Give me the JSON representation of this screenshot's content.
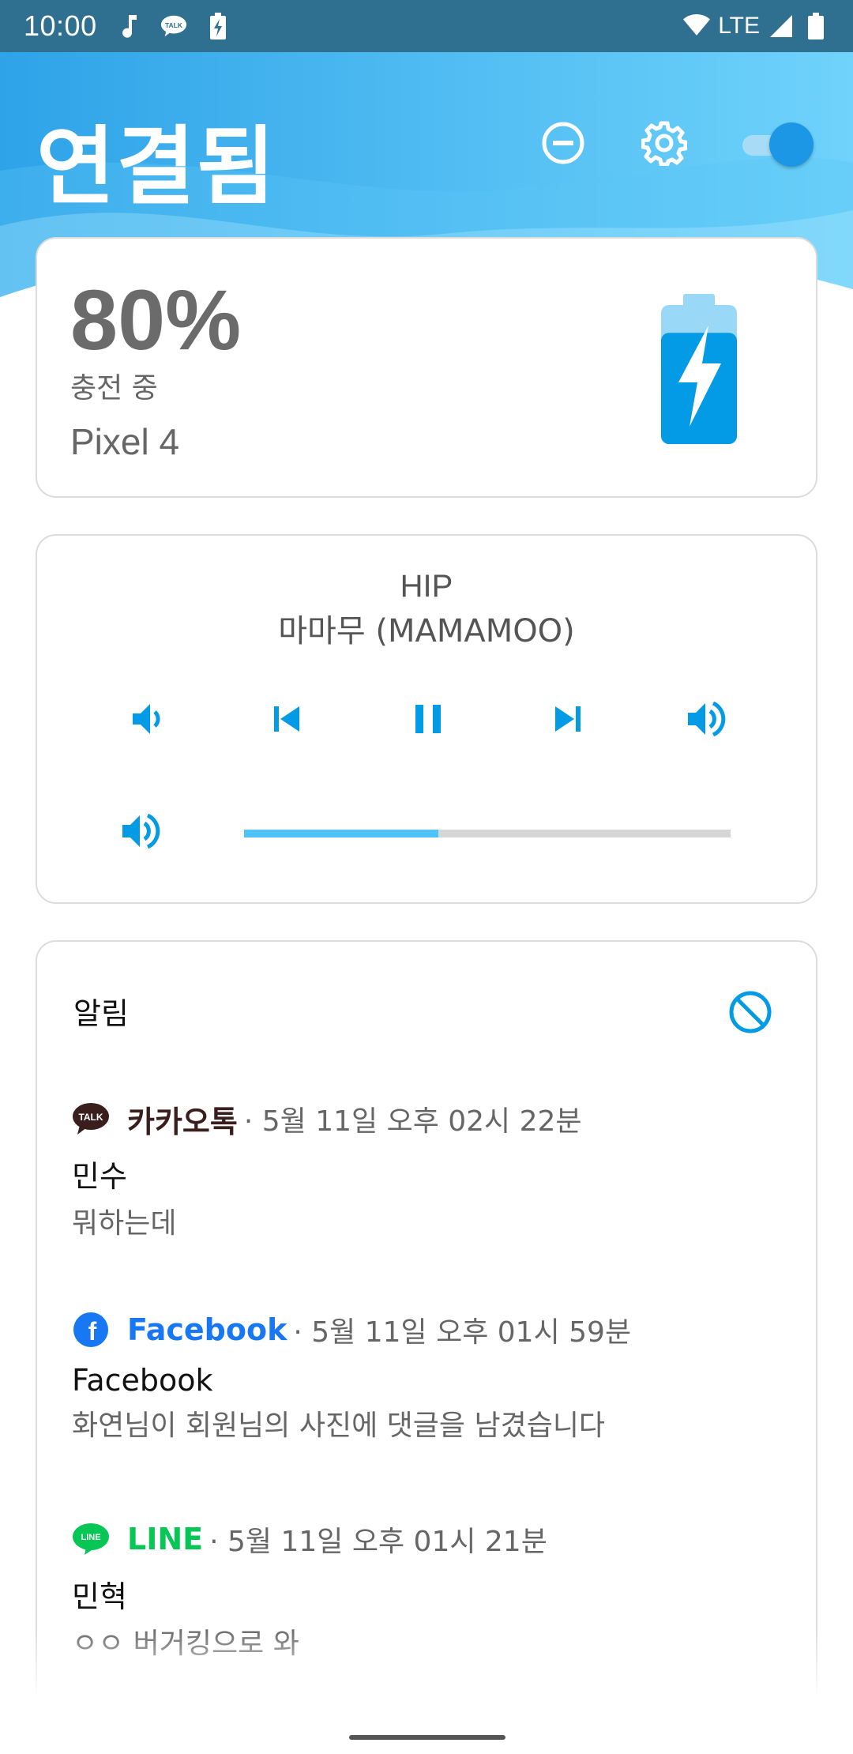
{
  "status_bar": {
    "time": "10:00",
    "network": "LTE",
    "icons": [
      "music-note-icon",
      "kakaotalk-talk-icon",
      "battery-charging-small-icon",
      "wifi-icon",
      "signal-icon",
      "battery-icon"
    ],
    "talk_label": "TALK"
  },
  "header": {
    "title": "연결됨",
    "actions": [
      "do-not-disturb-icon",
      "gear-icon",
      "toggle-switch"
    ],
    "toggle_on": true,
    "accent": "#1b97e6"
  },
  "battery": {
    "percent": "80%",
    "status": "충전 중",
    "device": "Pixel 4",
    "level": 0.8,
    "color": "#039be5"
  },
  "music": {
    "title": "HIP",
    "artist": "마마무 (MAMAMOO)",
    "controls": [
      "volume-down-icon",
      "skip-previous-icon",
      "pause-icon",
      "skip-next-icon",
      "volume-up-icon"
    ],
    "volume_level": 0.4,
    "accent": "#039be5"
  },
  "notifications": {
    "header": "알림",
    "items": [
      {
        "app": "카카오톡",
        "app_icon": "kakaotalk-icon",
        "app_color": "#3a1d1d",
        "time": "· 5월 11일 오후 02시 22분",
        "title": "민수",
        "text": "뭐하는데",
        "icon_label": "TALK"
      },
      {
        "app": "Facebook",
        "app_icon": "facebook-icon",
        "app_color": "#1877f2",
        "time": "· 5월 11일 오후 01시 59분",
        "title": "Facebook",
        "text": "화연님이 회원님의 사진에 댓글을 남겼습니다",
        "icon_label": "f"
      },
      {
        "app": "LINE",
        "app_icon": "line-icon",
        "app_color": "#06c755",
        "time": "· 5월 11일 오후 01시 21분",
        "title": "민혁",
        "text": "ㅇㅇ 버거킹으로 와",
        "icon_label": "LINE"
      }
    ]
  }
}
